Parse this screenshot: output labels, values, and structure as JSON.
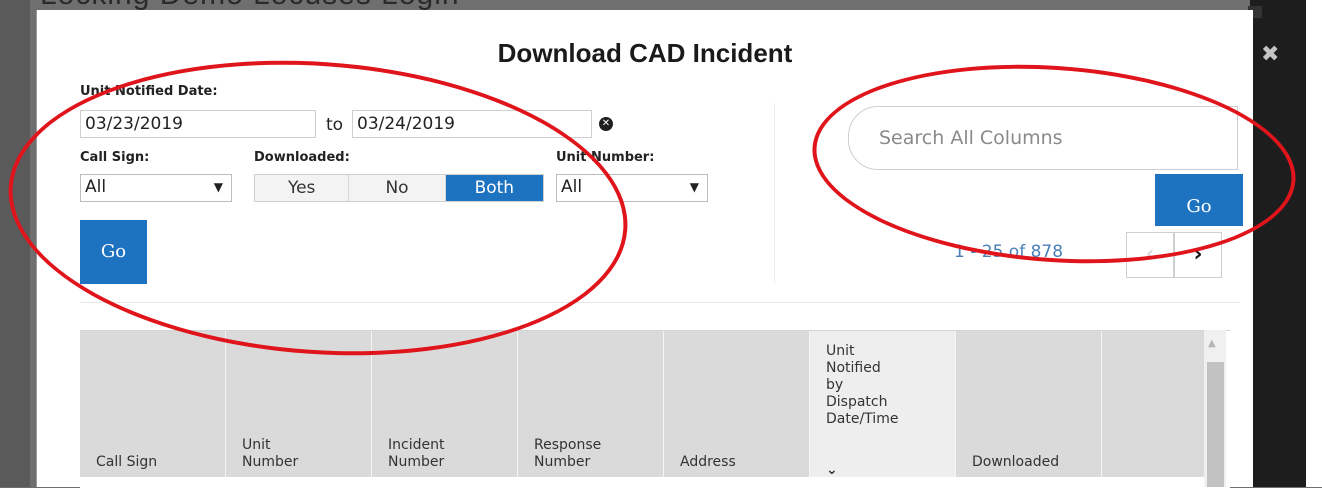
{
  "background": {
    "page_title": "Locking Demo Locuses Login"
  },
  "modal": {
    "title": "Download CAD Incident",
    "close_icon": "close-icon"
  },
  "filters": {
    "date_label": "Unit Notified Date:",
    "date_from": "03/23/2019",
    "to_label": "to",
    "date_to": "03/24/2019",
    "call_sign_label": "Call Sign:",
    "call_sign_value": "All",
    "downloaded_label": "Downloaded:",
    "downloaded_options": [
      "Yes",
      "No",
      "Both"
    ],
    "downloaded_selected": "Both",
    "unit_number_label": "Unit Number:",
    "unit_number_value": "All",
    "go_label": "Go"
  },
  "search": {
    "placeholder": "Search All Columns",
    "go_label": "Go"
  },
  "pager": {
    "range_text": "1 - 25 of 878",
    "prev_icon": "chevron-left-icon",
    "next_icon": "chevron-right-icon"
  },
  "table": {
    "columns": [
      "Call Sign",
      "Unit Number",
      "Incident Number",
      "Response Number",
      "Address",
      "Unit Notified by Dispatch Date/Time",
      "Downloaded",
      ""
    ]
  },
  "colors": {
    "accent": "#1e73c0",
    "annotation": "#e0141b"
  }
}
